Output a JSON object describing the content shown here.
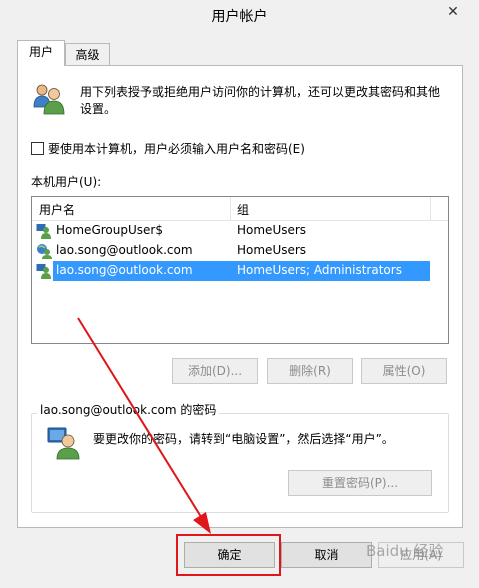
{
  "window": {
    "title": "用户帐户",
    "close_glyph": "✕"
  },
  "tabs": [
    {
      "label": "用户"
    },
    {
      "label": "高级"
    }
  ],
  "users_tab": {
    "description_line1": "用下列表授予或拒绝用户访问你的计算机，还可以更改其密码和其他",
    "description_line2": "设置。",
    "require_password_label": "要使用本计算机，用户必须输入用户名和密码(E)",
    "require_password_checked": false,
    "local_users_label": "本机用户(U):",
    "columns": [
      "用户名",
      "组"
    ],
    "rows": [
      {
        "name": "HomeGroupUser$",
        "group": "HomeUsers",
        "selected": false
      },
      {
        "name": "lao.song@outlook.com",
        "group": "HomeUsers",
        "selected": false
      },
      {
        "name": "lao.song@outlook.com",
        "group": "HomeUsers; Administrators",
        "selected": true
      }
    ],
    "buttons": {
      "add": "添加(D)...",
      "remove": "删除(R)",
      "properties": "属性(O)"
    },
    "password_group": {
      "title": "lao.song@outlook.com 的密码",
      "message": "要更改你的密码，请转到“电脑设置”，然后选择“用户”。",
      "reset_button": "重置密码(P)..."
    }
  },
  "dialog_buttons": {
    "ok": "确定",
    "cancel": "取消",
    "apply": "应用(A)"
  },
  "watermark": "Baidu 经验",
  "colors": {
    "selection": "#3399ff",
    "highlight_box": "#e0161a"
  }
}
